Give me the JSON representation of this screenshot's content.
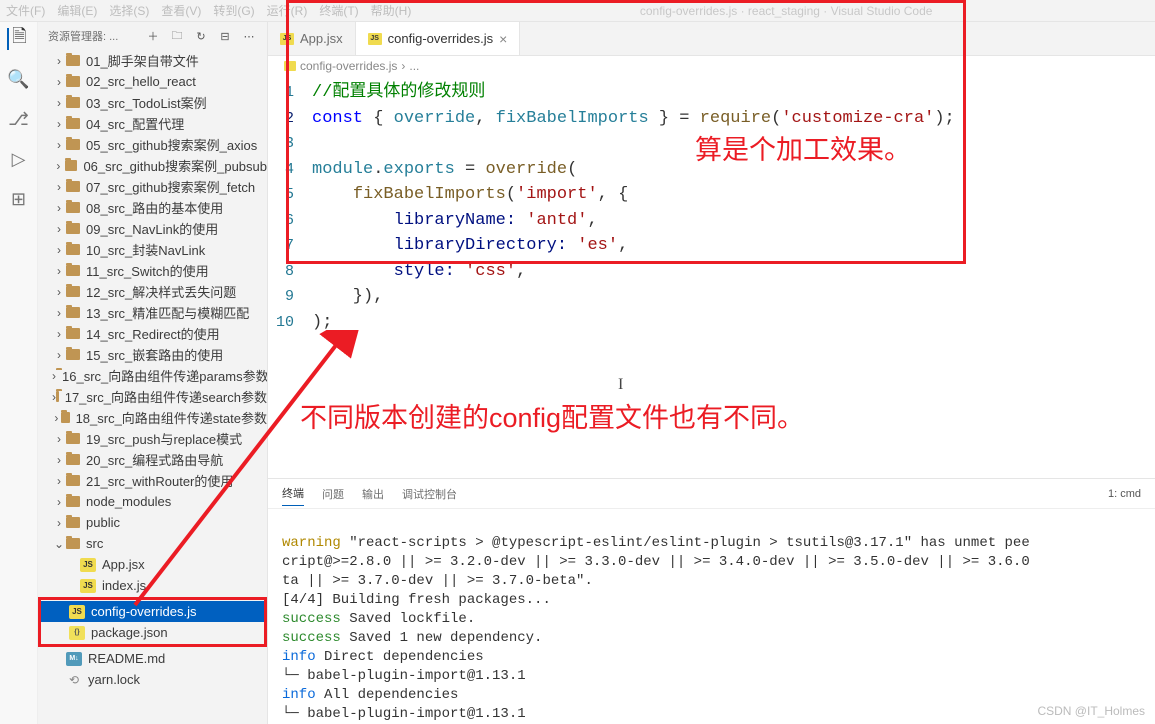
{
  "window": {
    "title": "config-overrides.js · react_staging · Visual Studio Code"
  },
  "menu": {
    "file": "文件(F)",
    "edit": "编辑(E)",
    "select": "选择(S)",
    "view": "查看(V)",
    "goto": "转到(G)",
    "run": "运行(R)",
    "terminal": "终端(T)",
    "help": "帮助(H)"
  },
  "sidebar": {
    "title": "资源管理器: ...",
    "folders": [
      "01_脚手架自带文件",
      "02_src_hello_react",
      "03_src_TodoList案例",
      "04_src_配置代理",
      "05_src_github搜索案例_axios",
      "06_src_github搜索案例_pubsub",
      "07_src_github搜索案例_fetch",
      "08_src_路由的基本使用",
      "09_src_NavLink的使用",
      "10_src_封装NavLink",
      "11_src_Switch的使用",
      "12_src_解决样式丢失问题",
      "13_src_精准匹配与模糊匹配",
      "14_src_Redirect的使用",
      "15_src_嵌套路由的使用",
      "16_src_向路由组件传递params参数",
      "17_src_向路由组件传递search参数",
      "18_src_向路由组件传递state参数",
      "19_src_push与replace模式",
      "20_src_编程式路由导航",
      "21_src_withRouter的使用",
      "node_modules",
      "public"
    ],
    "srcLabel": "src",
    "srcFiles": [
      "App.jsx",
      "index.js"
    ],
    "rootFiles": [
      "config-overrides.js",
      "package.json",
      "README.md",
      "yarn.lock"
    ]
  },
  "tabs": {
    "t1": "App.jsx",
    "t2": "config-overrides.js"
  },
  "breadcrumb": {
    "file": "config-overrides.js",
    "sep": "›",
    "rest": "..."
  },
  "code": {
    "l1": "//配置具体的修改规则",
    "l2a": "const",
    "l2b": " { ",
    "l2c": "override",
    "l2d": ", ",
    "l2e": "fixBabelImports",
    "l2f": " } = ",
    "l2g": "require",
    "l2h": "(",
    "l2i": "'customize-cra'",
    "l2j": ");",
    "l4a": "module",
    "l4b": ".",
    "l4c": "exports",
    "l4d": " = ",
    "l4e": "override",
    "l4f": "(",
    "l5a": "    ",
    "l5b": "fixBabelImports",
    "l5c": "(",
    "l5d": "'import'",
    "l5e": ", {",
    "l6a": "        ",
    "l6b": "libraryName:",
    "l6c": " ",
    "l6d": "'antd'",
    "l6e": ",",
    "l7a": "        ",
    "l7b": "libraryDirectory:",
    "l7c": " ",
    "l7d": "'es'",
    "l7e": ",",
    "l8a": "        ",
    "l8b": "style:",
    "l8c": " ",
    "l8d": "'css'",
    "l8e": ",",
    "l9": "    }),",
    "l10": ");"
  },
  "annotations": {
    "a1": "算是个加工效果。",
    "a2": "不同版本创建的config配置文件也有不同。"
  },
  "panel": {
    "tabs": {
      "terminal": "终端",
      "problems": "问题",
      "output": "输出",
      "debug": "调试控制台"
    },
    "right": "1: cmd"
  },
  "terminal": {
    "l1a": "warning",
    "l1b": " \"react-scripts > @typescript-eslint/eslint-plugin > tsutils@3.17.1\" has unmet pee",
    "l2": "cript@>=2.8.0 || >= 3.2.0-dev || >= 3.3.0-dev || >= 3.4.0-dev || >= 3.5.0-dev || >= 3.6.0",
    "l3": "ta || >= 3.7.0-dev || >= 3.7.0-beta\".",
    "l4": "[4/4] Building fresh packages...",
    "l5a": "success",
    "l5b": " Saved lockfile.",
    "l6a": "success",
    "l6b": " Saved 1 new dependency.",
    "l7a": "info",
    "l7b": " Direct dependencies",
    "l8": "└─ babel-plugin-import@1.13.1",
    "l9a": "info",
    "l9b": " All dependencies",
    "l10": "└─ babel-plugin-import@1.13.1"
  },
  "watermark": "CSDN @IT_Holmes"
}
